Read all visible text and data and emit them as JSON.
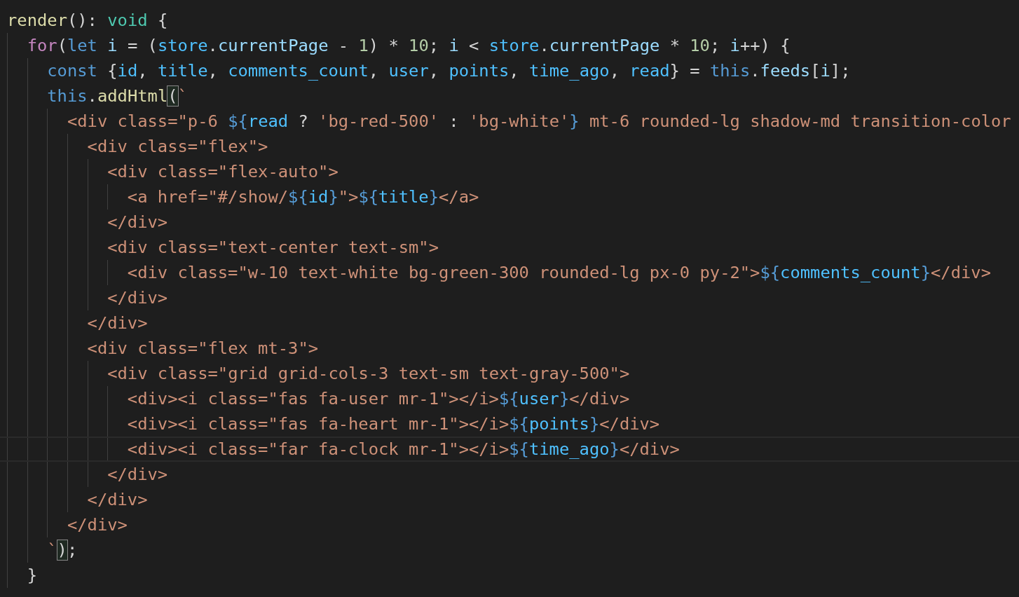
{
  "editor": {
    "lines": [
      {
        "current": false,
        "tokens": [
          {
            "kind": "fn",
            "text": "render"
          },
          {
            "kind": "punc",
            "text": "(): "
          },
          {
            "kind": "type",
            "text": "void"
          },
          {
            "kind": "punc",
            "text": " {"
          }
        ],
        "children": [
          {
            "current": false,
            "tokens": [
              {
                "kind": "kw",
                "text": "for"
              },
              {
                "kind": "punc",
                "text": "("
              },
              {
                "kind": "storage",
                "text": "let"
              },
              {
                "kind": "var",
                "text": " i"
              },
              {
                "kind": "punc",
                "text": " = ("
              },
              {
                "kind": "const",
                "text": "store"
              },
              {
                "kind": "punc",
                "text": "."
              },
              {
                "kind": "var",
                "text": "currentPage"
              },
              {
                "kind": "punc",
                "text": " - "
              },
              {
                "kind": "num",
                "text": "1"
              },
              {
                "kind": "punc",
                "text": ") * "
              },
              {
                "kind": "num",
                "text": "10"
              },
              {
                "kind": "punc",
                "text": "; "
              },
              {
                "kind": "var",
                "text": "i"
              },
              {
                "kind": "punc",
                "text": " < "
              },
              {
                "kind": "const",
                "text": "store"
              },
              {
                "kind": "punc",
                "text": "."
              },
              {
                "kind": "var",
                "text": "currentPage"
              },
              {
                "kind": "punc",
                "text": " * "
              },
              {
                "kind": "num",
                "text": "10"
              },
              {
                "kind": "punc",
                "text": "; "
              },
              {
                "kind": "var",
                "text": "i"
              },
              {
                "kind": "punc",
                "text": "++) {"
              }
            ],
            "children": [
              {
                "current": false,
                "tokens": [
                  {
                    "kind": "storage",
                    "text": "const"
                  },
                  {
                    "kind": "punc",
                    "text": " {"
                  },
                  {
                    "kind": "const",
                    "text": "id"
                  },
                  {
                    "kind": "punc",
                    "text": ", "
                  },
                  {
                    "kind": "const",
                    "text": "title"
                  },
                  {
                    "kind": "punc",
                    "text": ", "
                  },
                  {
                    "kind": "const",
                    "text": "comments_count"
                  },
                  {
                    "kind": "punc",
                    "text": ", "
                  },
                  {
                    "kind": "const",
                    "text": "user"
                  },
                  {
                    "kind": "punc",
                    "text": ", "
                  },
                  {
                    "kind": "const",
                    "text": "points"
                  },
                  {
                    "kind": "punc",
                    "text": ", "
                  },
                  {
                    "kind": "const",
                    "text": "time_ago"
                  },
                  {
                    "kind": "punc",
                    "text": ", "
                  },
                  {
                    "kind": "const",
                    "text": "read"
                  },
                  {
                    "kind": "punc",
                    "text": "} = "
                  },
                  {
                    "kind": "storage",
                    "text": "this"
                  },
                  {
                    "kind": "punc",
                    "text": "."
                  },
                  {
                    "kind": "var",
                    "text": "feeds"
                  },
                  {
                    "kind": "punc",
                    "text": "["
                  },
                  {
                    "kind": "var",
                    "text": "i"
                  },
                  {
                    "kind": "punc",
                    "text": "];"
                  }
                ]
              },
              {
                "current": false,
                "tokens": [
                  {
                    "kind": "storage",
                    "text": "this"
                  },
                  {
                    "kind": "punc",
                    "text": "."
                  },
                  {
                    "kind": "fn",
                    "text": "addHtml"
                  },
                  {
                    "kind": "bracket",
                    "text": "("
                  },
                  {
                    "kind": "str",
                    "text": "`"
                  }
                ],
                "children": [
                  {
                    "current": false,
                    "tokens": [
                      {
                        "kind": "str",
                        "text": "<div class=\"p-6 "
                      },
                      {
                        "kind": "tpl",
                        "text": "${"
                      },
                      {
                        "kind": "const",
                        "text": "read"
                      },
                      {
                        "kind": "punc",
                        "text": " ? "
                      },
                      {
                        "kind": "str",
                        "text": "'bg-red-500'"
                      },
                      {
                        "kind": "punc",
                        "text": " : "
                      },
                      {
                        "kind": "str",
                        "text": "'bg-white'"
                      },
                      {
                        "kind": "tpl",
                        "text": "}"
                      },
                      {
                        "kind": "str",
                        "text": " mt-6 rounded-lg shadow-md transition-color"
                      }
                    ],
                    "children": [
                      {
                        "current": false,
                        "tokens": [
                          {
                            "kind": "str",
                            "text": "<div class=\"flex\">"
                          }
                        ],
                        "children": [
                          {
                            "current": false,
                            "tokens": [
                              {
                                "kind": "str",
                                "text": "<div class=\"flex-auto\">"
                              }
                            ],
                            "children": [
                              {
                                "current": false,
                                "tokens": [
                                  {
                                    "kind": "str",
                                    "text": "<a href=\"#/show/"
                                  },
                                  {
                                    "kind": "tpl",
                                    "text": "${"
                                  },
                                  {
                                    "kind": "const",
                                    "text": "id"
                                  },
                                  {
                                    "kind": "tpl",
                                    "text": "}"
                                  },
                                  {
                                    "kind": "str",
                                    "text": "\">"
                                  },
                                  {
                                    "kind": "tpl",
                                    "text": "${"
                                  },
                                  {
                                    "kind": "const",
                                    "text": "title"
                                  },
                                  {
                                    "kind": "tpl",
                                    "text": "}"
                                  },
                                  {
                                    "kind": "str",
                                    "text": "</a>"
                                  }
                                ]
                              }
                            ]
                          },
                          {
                            "current": false,
                            "tokens": [
                              {
                                "kind": "str",
                                "text": "</div>"
                              }
                            ]
                          },
                          {
                            "current": false,
                            "tokens": [
                              {
                                "kind": "str",
                                "text": "<div class=\"text-center text-sm\">"
                              }
                            ],
                            "children": [
                              {
                                "current": false,
                                "tokens": [
                                  {
                                    "kind": "str",
                                    "text": "<div class=\"w-10 text-white bg-green-300 rounded-lg px-0 py-2\">"
                                  },
                                  {
                                    "kind": "tpl",
                                    "text": "${"
                                  },
                                  {
                                    "kind": "const",
                                    "text": "comments_count"
                                  },
                                  {
                                    "kind": "tpl",
                                    "text": "}"
                                  },
                                  {
                                    "kind": "str",
                                    "text": "</div>"
                                  }
                                ]
                              }
                            ]
                          },
                          {
                            "current": false,
                            "tokens": [
                              {
                                "kind": "str",
                                "text": "</div>"
                              }
                            ]
                          }
                        ]
                      },
                      {
                        "current": false,
                        "tokens": [
                          {
                            "kind": "str",
                            "text": "</div>"
                          }
                        ]
                      },
                      {
                        "current": false,
                        "tokens": [
                          {
                            "kind": "str",
                            "text": "<div class=\"flex mt-3\">"
                          }
                        ],
                        "children": [
                          {
                            "current": false,
                            "tokens": [
                              {
                                "kind": "str",
                                "text": "<div class=\"grid grid-cols-3 text-sm text-gray-500\">"
                              }
                            ],
                            "children": [
                              {
                                "current": false,
                                "tokens": [
                                  {
                                    "kind": "str",
                                    "text": "<div><i class=\"fas fa-user mr-1\"></i>"
                                  },
                                  {
                                    "kind": "tpl",
                                    "text": "${"
                                  },
                                  {
                                    "kind": "const",
                                    "text": "user"
                                  },
                                  {
                                    "kind": "tpl",
                                    "text": "}"
                                  },
                                  {
                                    "kind": "str",
                                    "text": "</div>"
                                  }
                                ]
                              },
                              {
                                "current": false,
                                "tokens": [
                                  {
                                    "kind": "str",
                                    "text": "<div><i class=\"fas fa-heart mr-1\"></i>"
                                  },
                                  {
                                    "kind": "tpl",
                                    "text": "${"
                                  },
                                  {
                                    "kind": "const",
                                    "text": "points"
                                  },
                                  {
                                    "kind": "tpl",
                                    "text": "}"
                                  },
                                  {
                                    "kind": "str",
                                    "text": "</div>"
                                  }
                                ]
                              },
                              {
                                "current": true,
                                "tokens": [
                                  {
                                    "kind": "str",
                                    "text": "<div><i class=\"far fa-clock mr-1\"></i>"
                                  },
                                  {
                                    "kind": "tpl",
                                    "text": "${"
                                  },
                                  {
                                    "kind": "const",
                                    "text": "time_ago"
                                  },
                                  {
                                    "kind": "tpl",
                                    "text": "}"
                                  },
                                  {
                                    "kind": "str",
                                    "text": "</div>"
                                  }
                                ]
                              }
                            ]
                          },
                          {
                            "current": false,
                            "tokens": [
                              {
                                "kind": "str",
                                "text": "</div>"
                              }
                            ]
                          }
                        ]
                      },
                      {
                        "current": false,
                        "tokens": [
                          {
                            "kind": "str",
                            "text": "</div>"
                          }
                        ]
                      }
                    ]
                  },
                  {
                    "current": false,
                    "tokens": [
                      {
                        "kind": "str",
                        "text": "</div>"
                      }
                    ]
                  }
                ]
              },
              {
                "current": false,
                "tokens": [
                  {
                    "kind": "str",
                    "text": "`"
                  },
                  {
                    "kind": "bracket",
                    "text": ")"
                  },
                  {
                    "kind": "punc",
                    "text": ";"
                  }
                ]
              }
            ]
          },
          {
            "current": false,
            "tokens": [
              {
                "kind": "punc",
                "text": "}"
              }
            ]
          }
        ]
      }
    ]
  }
}
